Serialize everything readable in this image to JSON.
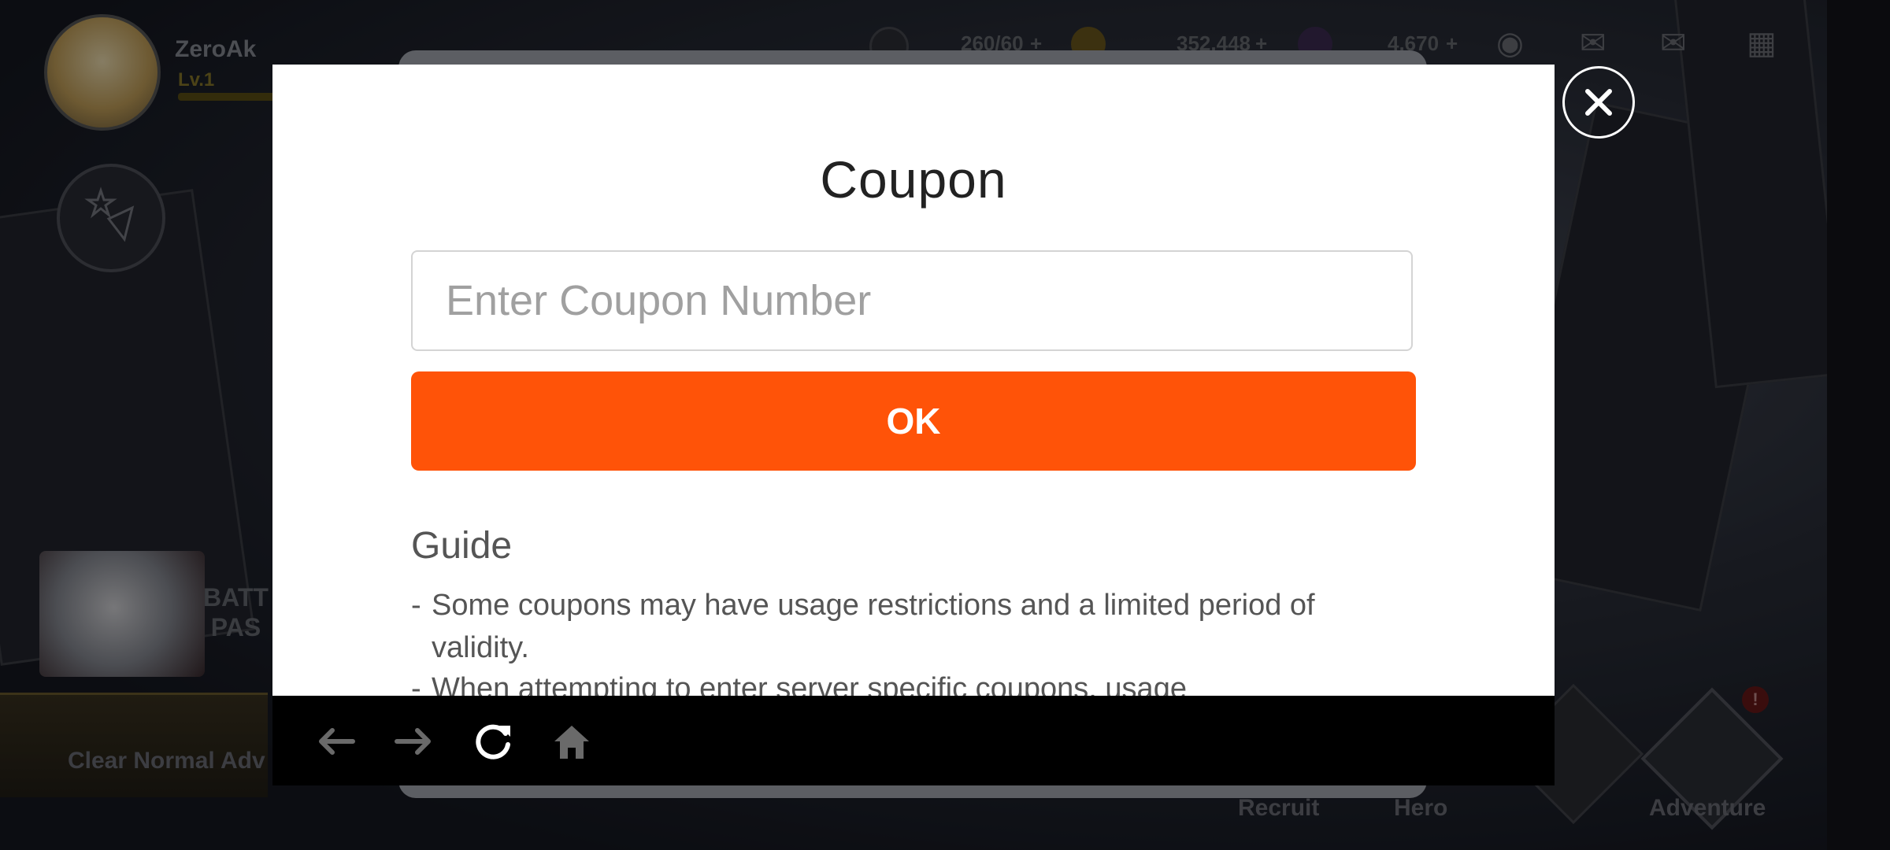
{
  "hud": {
    "player_name": "ZeroAk",
    "player_level": "Lv.1",
    "stamina": "260/60",
    "gold": "352,448",
    "gems": "4,670",
    "plus": "+"
  },
  "side": {
    "battle_pass_line1": "BATT",
    "battle_pass_line2": "PAS",
    "quest": "Clear Normal Adv"
  },
  "bottom_nav": {
    "recruit": "Recruit",
    "hero": "Hero",
    "adventure": "Adventure",
    "alert": "!"
  },
  "modal": {
    "title": "Coupon",
    "input_placeholder": "Enter Coupon Number",
    "input_value": "",
    "ok_label": "OK",
    "guide_title": "Guide",
    "guide_items": [
      "Some coupons may have usage restrictions and a limited period of validity.",
      "When attempting to enter server specific coupons, usage"
    ],
    "dash": "-"
  },
  "toolbar": {
    "back_icon": "arrow-left-icon",
    "forward_icon": "arrow-right-icon",
    "refresh_icon": "refresh-icon",
    "home_icon": "home-icon"
  },
  "colors": {
    "ok_button": "#ff5308",
    "modal_bg": "#ffffff",
    "toolbar_bg": "#000000"
  }
}
